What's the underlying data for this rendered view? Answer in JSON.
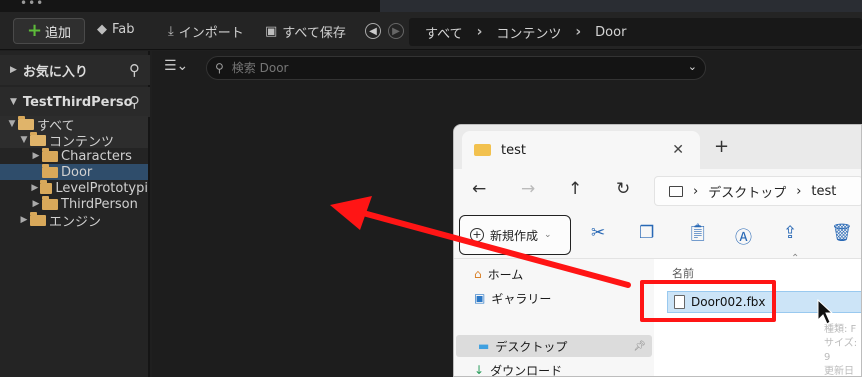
{
  "toolbar": {
    "add_label": "追加",
    "fab_label": "Fab",
    "import_label": "インポート",
    "save_all_label": "すべて保存"
  },
  "path": {
    "items": [
      "すべて",
      "コンテンツ",
      "Door"
    ]
  },
  "favorites": {
    "label": "お気に入り"
  },
  "project": {
    "label": "TestThirdPerso"
  },
  "tree": [
    {
      "label": "すべて",
      "indent": 0
    },
    {
      "label": "コンテンツ",
      "indent": 1
    },
    {
      "label": "Characters",
      "indent": 2
    },
    {
      "label": "Door",
      "indent": 2
    },
    {
      "label": "LevelPrototypi",
      "indent": 2
    },
    {
      "label": "ThirdPerson",
      "indent": 2
    },
    {
      "label": "エンジン",
      "indent": 1
    }
  ],
  "search": {
    "placeholder": "検索 Door"
  },
  "explorer": {
    "tab_title": "test",
    "address_items": [
      "デスクトップ",
      "test"
    ],
    "new_label": "新規作成",
    "sidebar": [
      "ホーム",
      "ギャラリー",
      "デスクトップ",
      "ダウンロード"
    ],
    "column_name": "名前",
    "file_name": "Door002.fbx",
    "details": [
      "種類: F",
      "サイズ: 9",
      "更新日"
    ]
  },
  "colors": {
    "selection": "#2f4d6b",
    "accent_add": "#5dbb3a",
    "annotation": "#ff1515"
  }
}
